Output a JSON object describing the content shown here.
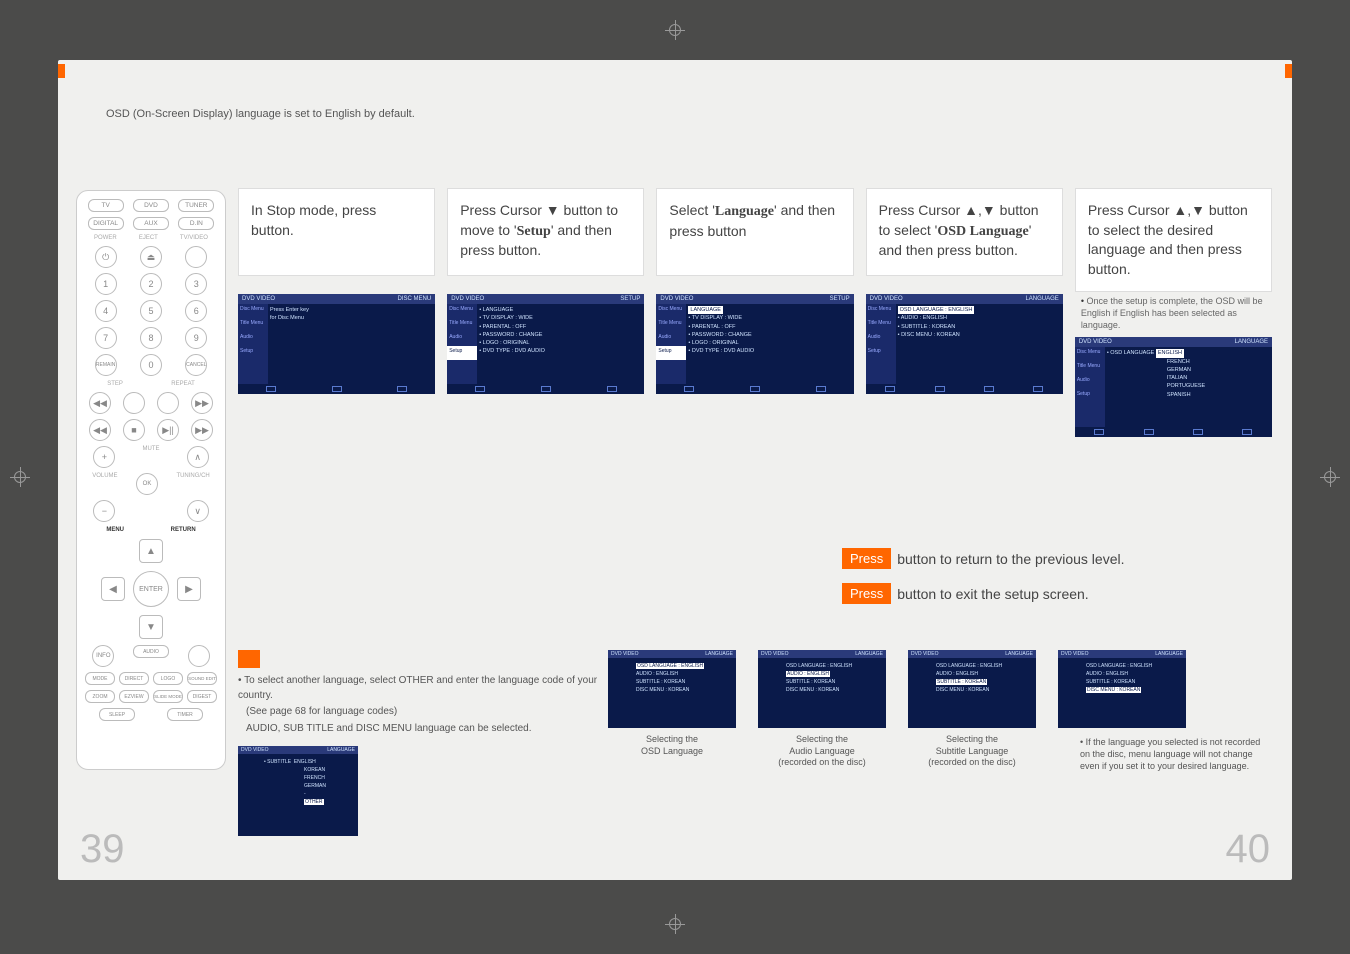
{
  "intro_text": "OSD (On-Screen Display) language is set to English by default.",
  "remote": {
    "src_buttons": [
      "TV",
      "DVD",
      "TUNER",
      "DIGITAL",
      "AUX",
      "D.IN"
    ],
    "labels": {
      "power": "POWER",
      "eject": "EJECT",
      "tvvideo": "TV/VIDEO",
      "step": "STEP",
      "repeat": "REPEAT",
      "mute": "MUTE",
      "volume": "VOLUME",
      "tuning": "TUNING/CH",
      "menu": "MENU",
      "return": "RETURN",
      "enter": "ENTER",
      "ok": "OK"
    },
    "numpad": [
      "1",
      "2",
      "3",
      "4",
      "5",
      "6",
      "7",
      "8",
      "9",
      "REMAIN",
      "0",
      "CANCEL"
    ],
    "transport": [
      "◀◀",
      "■",
      "▶▶"
    ],
    "skip": [
      "◀◀",
      "▶▶"
    ],
    "bottom_labels": [
      "MODE",
      "DIRECT",
      "SLEEP",
      "TIMER",
      "ZOOM",
      "EZVIEW",
      "SLIDE MODE",
      "DIGEST",
      "LOGO",
      "SOUND EDIT"
    ]
  },
  "steps": [
    {
      "text_parts": [
        "In Stop mode, press",
        "button."
      ],
      "shot": {
        "topbar_left": "DVD VIDEO",
        "topbar_right": "DISC MENU",
        "center_lines": [
          "Press Enter key",
          "for Disc Menu"
        ]
      }
    },
    {
      "text_parts": [
        "Press Cursor ▼ button to move to '",
        "Setup",
        "' and then press",
        "button."
      ],
      "shot": {
        "topbar_left": "DVD VIDEO",
        "topbar_right": "SETUP",
        "rows": [
          "LANGUAGE",
          "TV DISPLAY : WIDE",
          "PARENTAL : OFF",
          "PASSWORD : CHANGE",
          "LOGO : ORIGINAL",
          "DVD TYPE : DVD AUDIO"
        ]
      }
    },
    {
      "text_parts": [
        "Select '",
        "Language",
        "' and then press",
        "button"
      ],
      "shot": {
        "topbar_left": "DVD VIDEO",
        "topbar_right": "SETUP",
        "rows": [
          "LANGUAGE",
          "TV DISPLAY : WIDE",
          "PARENTAL : OFF",
          "PASSWORD : CHANGE",
          "LOGO : ORIGINAL",
          "DVD TYPE : DVD AUDIO"
        ],
        "highlight": 0
      }
    },
    {
      "text_parts": [
        "Press Cursor ▲,▼ button to select '",
        "OSD Language",
        "' and then press",
        "button."
      ],
      "shot": {
        "topbar_left": "DVD VIDEO",
        "topbar_right": "LANGUAGE",
        "rows": [
          "OSD LANGUAGE : ENGLISH",
          "AUDIO : ENGLISH",
          "SUBTITLE : KOREAN",
          "DISC MENU : KOREAN"
        ],
        "highlight": 0
      }
    },
    {
      "text_parts": [
        "Press Cursor ▲,▼ button to select the desired language and then press",
        "button."
      ],
      "note": "Once the setup is complete, the OSD will be English if English has been selected as language.",
      "shot": {
        "topbar_left": "DVD VIDEO",
        "topbar_right": "LANGUAGE",
        "rows_left": "OSD LANGUAGE",
        "langs": [
          "ENGLISH",
          "FRENCH",
          "GERMAN",
          "ITALIAN",
          "PORTUGUESE",
          "SPANISH"
        ],
        "highlight": 0
      }
    }
  ],
  "prompts": {
    "row1": [
      "Press",
      "button to return to the previous level."
    ],
    "row2": [
      "Press",
      "button to exit the setup screen."
    ]
  },
  "note_block": {
    "l1": "• To select another language, select OTHER and enter the language code of your country.",
    "l2": "(See page 68 for language codes)",
    "l3": "AUDIO, SUB TITLE and DISC MENU language can be selected.",
    "shot": {
      "topbar_left": "DVD VIDEO",
      "topbar_right": "LANGUAGE",
      "rows": [
        "SUBTITLE",
        "ENGLISH",
        "KOREAN",
        "FRENCH",
        "GERMAN",
        "-",
        "OTHER"
      ]
    }
  },
  "small_screens": [
    {
      "rows": [
        "OSD LANGUAGE : ENGLISH",
        "AUDIO : ENGLISH",
        "SUBTITLE : KOREAN",
        "DISC MENU : KOREAN"
      ],
      "hl": 0,
      "cap1": "Selecting the",
      "cap2": "OSD Language"
    },
    {
      "rows": [
        "OSD LANGUAGE : ENGLISH",
        "AUDIO : ENGLISH",
        "SUBTITLE : KOREAN",
        "DISC MENU : KOREAN"
      ],
      "hl": 1,
      "cap1": "Selecting the",
      "cap2": "Audio Language",
      "cap3": "(recorded on the disc)"
    },
    {
      "rows": [
        "OSD LANGUAGE : ENGLISH",
        "AUDIO : ENGLISH",
        "SUBTITLE : KOREAN",
        "DISC MENU : KOREAN"
      ],
      "hl": 2,
      "cap1": "Selecting the",
      "cap2": "Subtitle Language",
      "cap3": "(recorded on the disc)"
    },
    {
      "rows": [
        "OSD LANGUAGE : ENGLISH",
        "AUDIO : ENGLISH",
        "SUBTITLE : KOREAN",
        "DISC MENU : KOREAN"
      ],
      "hl": 3,
      "cap1": "",
      "cap2": ""
    }
  ],
  "footer_note": "If the language you selected is not recorded on the disc, menu language will not change even if you set it to your desired language.",
  "page_left": "39",
  "page_right": "40"
}
